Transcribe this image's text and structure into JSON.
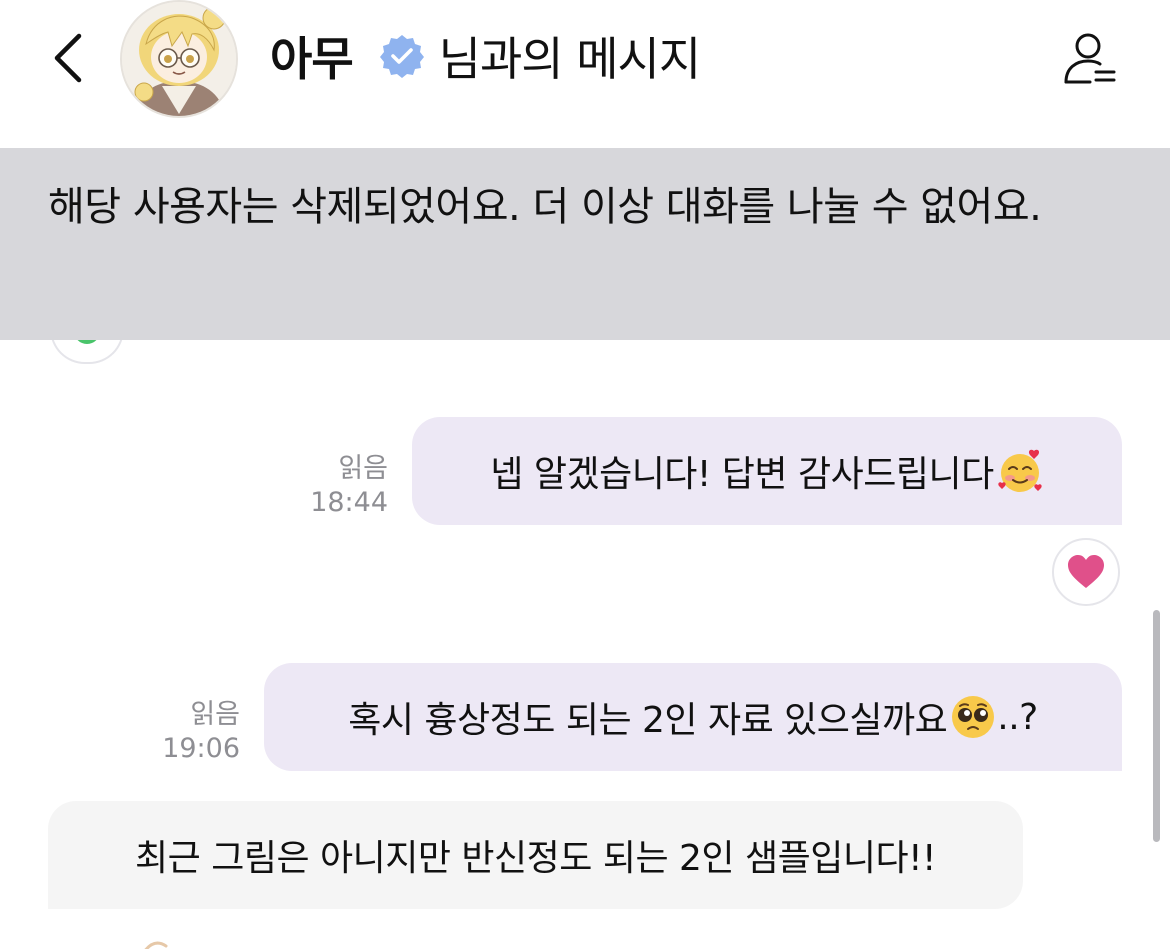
{
  "header": {
    "name": "아무",
    "title_suffix": "님과의 메시지",
    "icons": {
      "back": "chevron-left-icon",
      "verified": "verified-badge-icon",
      "profile": "profile-menu-icon"
    },
    "verified_color": "#8fb3ef"
  },
  "banner": {
    "text": "해당 사용자는 삭제되었어요. 더 이상 대화를 나눌 수 없어요.",
    "background": "#d7d7db"
  },
  "messages": [
    {
      "direction": "outgoing",
      "status": "읽음",
      "time": "18:44",
      "text": "넵 알겠습니다! 답변 감사드립니다",
      "emoji": "smiling-face-with-hearts",
      "reaction": "heart-icon"
    },
    {
      "direction": "outgoing",
      "status": "읽음",
      "time": "19:06",
      "text": "혹시 흉상정도 되는 2인 자료 있으실까요",
      "emoji": "pleading-face",
      "text_after": "..?"
    },
    {
      "direction": "incoming",
      "text": "최근 그림은 아니지만 반신정도 되는 2인 샘플입니다!!"
    }
  ],
  "colors": {
    "outgoing_bubble": "#ede8f5",
    "incoming_bubble": "#f5f5f5",
    "meta_text": "#8e8e93",
    "reaction_heart": "#e0508a"
  }
}
